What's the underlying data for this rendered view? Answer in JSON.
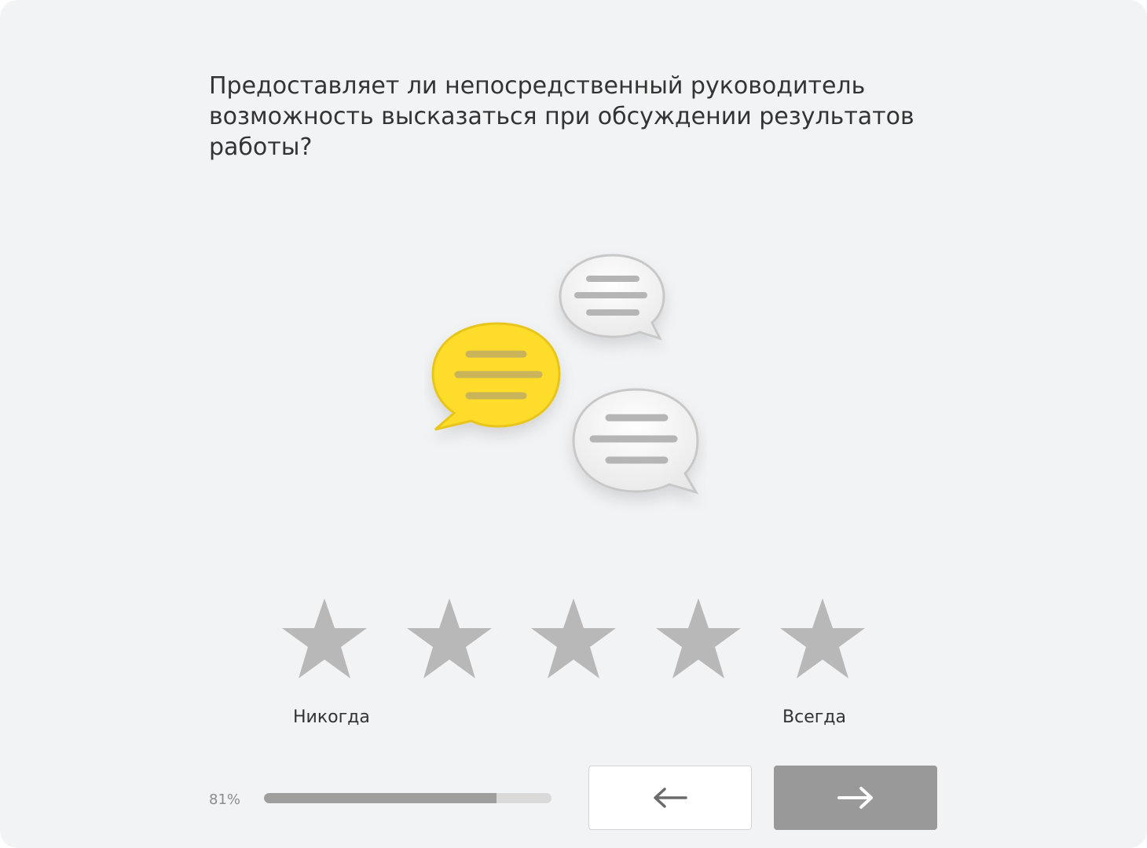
{
  "question": {
    "text": "Предоставляет ли непосредственный руководитель возможность высказаться при обсуждении результатов работы?"
  },
  "illustration": {
    "icon": "chat-bubbles-icon",
    "colors": {
      "accent_bubble": "#fddc2a",
      "gray_bubble": "#f7f7f7",
      "bubble_lines_on_yellow": "#c9b45a",
      "bubble_lines_on_gray": "#b5b5b5"
    }
  },
  "rating": {
    "max": 5,
    "selected": 0,
    "star_color": "#b8b8b8",
    "min_label": "Никогда",
    "max_label": "Всегда"
  },
  "progress": {
    "value": 0.81,
    "label": "81%"
  },
  "navigation": {
    "prev_icon": "arrow-left-icon",
    "next_icon": "arrow-right-icon",
    "next_button_color": "#999999"
  }
}
